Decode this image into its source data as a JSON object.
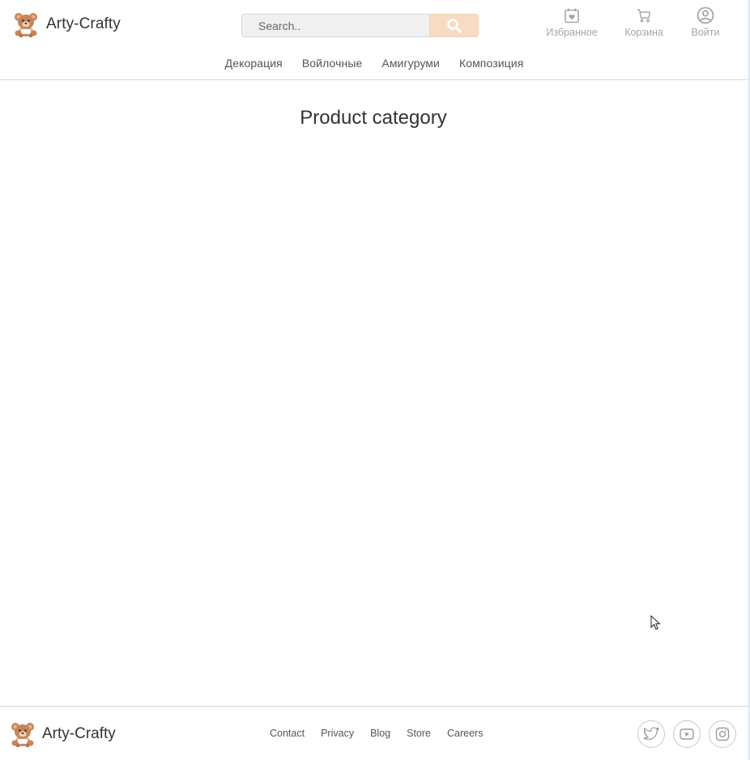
{
  "header": {
    "brand": "Arty-Crafty",
    "search": {
      "placeholder": "Search..",
      "value": ""
    },
    "icons": [
      {
        "label": "Избранное",
        "icon": "favorites-calendar-icon"
      },
      {
        "label": "Корзина",
        "icon": "cart-icon"
      },
      {
        "label": "Войти",
        "icon": "user-circle-icon"
      }
    ],
    "nav": [
      "Декорация",
      "Войлочные",
      "Амигуруми",
      "Композиция"
    ]
  },
  "main": {
    "title": "Product category"
  },
  "footer": {
    "brand": "Arty-Crafty",
    "links": [
      "Contact",
      "Privacy",
      "Blog",
      "Store",
      "Careers"
    ],
    "social": [
      "twitter-icon",
      "youtube-icon",
      "instagram-icon"
    ]
  },
  "colors": {
    "search_button": "#f7dcc3",
    "muted_label": "#a6a6a6",
    "text": "#333333"
  }
}
